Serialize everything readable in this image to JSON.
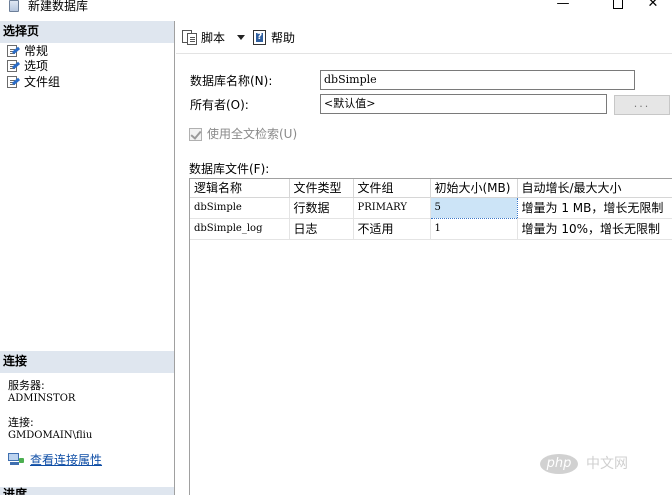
{
  "window": {
    "title": "新建数据库",
    "minimize_glyph": "—",
    "close_glyph": "✕"
  },
  "left_pane": {
    "select_page_header": "选择页",
    "pages": [
      {
        "label": "常规",
        "icon": "page-settings-icon"
      },
      {
        "label": "选项",
        "icon": "page-settings-icon"
      },
      {
        "label": "文件组",
        "icon": "page-settings-icon"
      }
    ],
    "connection_header": "连接",
    "server_label": "服务器:",
    "server_value": "ADMINSTOR",
    "connection_label": "连接:",
    "connection_value": "GMDOMAIN\\fliu",
    "view_connection_link": "查看连接属性",
    "progress_header": "进度"
  },
  "toolbar": {
    "script_label": "脚本",
    "help_label": "帮助"
  },
  "form": {
    "db_name_label": "数据库名称(N):",
    "db_name_value": "dbSimple",
    "owner_label": "所有者(O):",
    "owner_value": "<默认值>",
    "owner_browse_label": "...",
    "fulltext_label": "使用全文检索(U)",
    "fulltext_checked": true,
    "files_label": "数据库文件(F):"
  },
  "files_grid": {
    "columns": [
      "逻辑名称",
      "文件类型",
      "文件组",
      "初始大小(MB)",
      "自动增长/最大大小"
    ],
    "rows": [
      [
        "dbSimple",
        "行数据",
        "PRIMARY",
        "5",
        "增量为 1 MB，增长无限制"
      ],
      [
        "dbSimple_log",
        "日志",
        "不适用",
        "1",
        "增量为 10%，增长无限制"
      ]
    ]
  },
  "watermark": {
    "logo_text": "php",
    "site_text": "中文网"
  }
}
